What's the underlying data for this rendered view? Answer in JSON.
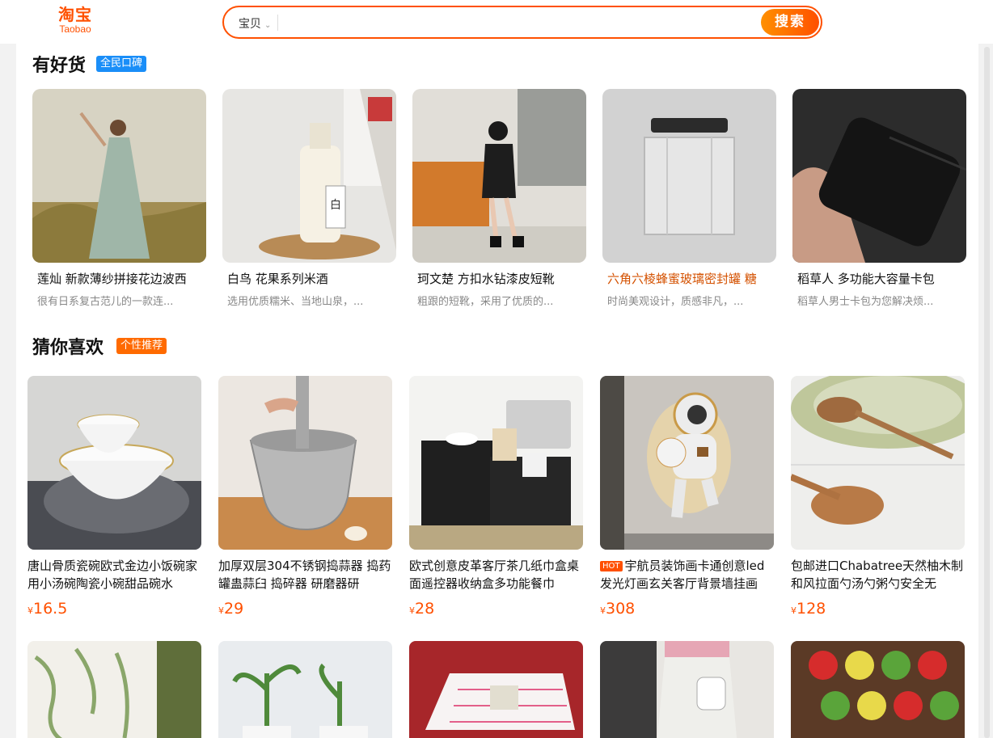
{
  "header": {
    "logo_cn": "淘宝",
    "logo_en": "Taobao",
    "search_scope": "宝贝",
    "search_value": "",
    "search_button": "搜索"
  },
  "good_section": {
    "title": "有好货",
    "badge": "全民口碑",
    "items": [
      {
        "name": "莲灿 新款薄纱拼接花边波西",
        "desc": "很有日系复古范儿的一款连..."
      },
      {
        "name": "白鸟 花果系列米酒",
        "desc": "选用优质糯米、当地山泉，..."
      },
      {
        "name": "珂文楚 方扣水钻漆皮短靴",
        "desc": "粗跟的短靴，采用了优质的..."
      },
      {
        "name": "六角六棱蜂蜜玻璃密封罐 糖",
        "desc": "时尚美观设计，质感非凡，..."
      },
      {
        "name": "稻草人 多功能大容量卡包",
        "desc": "稻草人男士卡包为您解决烦..."
      }
    ]
  },
  "recommend_section": {
    "title": "猜你喜欢",
    "badge": "个性推荐",
    "items": [
      {
        "title": "唐山骨质瓷碗欧式金边小饭碗家用小汤碗陶瓷小碗甜品碗水",
        "currency": "¥",
        "price": "16.5",
        "hot": ""
      },
      {
        "title": "加厚双层304不锈钢捣蒜器 捣药罐蛊蒜臼 捣碎器 研磨器研",
        "currency": "¥",
        "price": "29",
        "hot": ""
      },
      {
        "title": "欧式创意皮革客厅茶几纸巾盒桌面遥控器收纳盒多功能餐巾",
        "currency": "¥",
        "price": "28",
        "hot": ""
      },
      {
        "title": "宇航员装饰画卡通创意led发光灯画玄关客厅背景墙挂画",
        "currency": "¥",
        "price": "308",
        "hot": "HOT"
      },
      {
        "title": "包邮进口Chabatree天然柚木制和风拉面勺汤勺粥勺安全无",
        "currency": "¥",
        "price": "128",
        "hot": ""
      }
    ]
  },
  "colors": {
    "accent": "#ff5000",
    "blue_badge": "#1a8ef8",
    "orange_badge": "#ff6a00"
  }
}
